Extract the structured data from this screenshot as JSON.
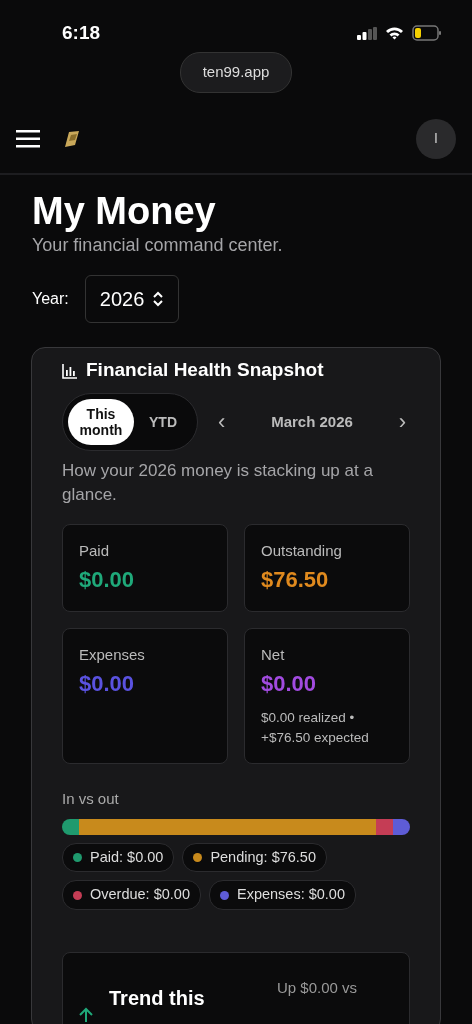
{
  "status_bar": {
    "time": "6:18"
  },
  "browser": {
    "url": "ten99.app"
  },
  "header": {
    "avatar_initial": "I"
  },
  "page": {
    "title": "My Money",
    "subtitle": "Your financial command center."
  },
  "year_picker": {
    "label": "Year:",
    "value": "2026"
  },
  "snapshot": {
    "title": "Financial Health Snapshot",
    "periods": [
      {
        "label": "This month",
        "selected": true
      },
      {
        "label": "YTD",
        "selected": false
      }
    ],
    "prev": "‹",
    "month": "March 2026",
    "next": "›",
    "description": "How your 2026 money is stacking up at a glance.",
    "metrics": [
      {
        "label": "Paid",
        "value": "$0.00",
        "color": "#1fa97a"
      },
      {
        "label": "Outstanding",
        "value": "$76.50",
        "color": "#e08a1e"
      },
      {
        "label": "Expenses",
        "value": "$0.00",
        "color": "#5a52e0"
      },
      {
        "label": "Net",
        "value": "$0.00",
        "color": "#a24be0",
        "note": "$0.00 realized • +$76.50 expected"
      }
    ],
    "bar_title": "In vs out",
    "segments": [
      {
        "label": "Paid: $0.00",
        "color": "#1f9a6e",
        "kind": "stub"
      },
      {
        "label": "Pending: $76.50",
        "color": "#c88a1c",
        "kind": "fill"
      },
      {
        "label": "Overdue: $0.00",
        "color": "#c53d55",
        "kind": "stub"
      },
      {
        "label": "Expenses: $0.00",
        "color": "#5e5cd6",
        "kind": "stub"
      }
    ],
    "trend": {
      "title": "Trend this",
      "comparison": "Up $0.00 vs"
    }
  }
}
